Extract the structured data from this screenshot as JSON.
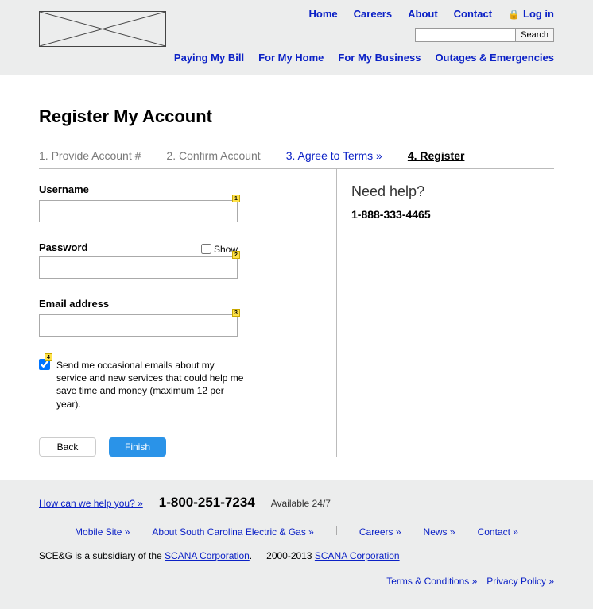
{
  "header": {
    "topNav": {
      "home": "Home",
      "careers": "Careers",
      "about": "About",
      "contact": "Contact",
      "login": "Log in"
    },
    "search": {
      "button": "Search"
    },
    "mainNav": {
      "bill": "Paying My Bill",
      "home": "For My Home",
      "business": "For My Business",
      "outages": "Outages & Emergencies"
    }
  },
  "page": {
    "title": "Register My Account",
    "steps": {
      "s1": "1. Provide Account #",
      "s2": "2. Confirm Account",
      "s3": "3. Agree to Terms »",
      "s4": "4. Register"
    },
    "form": {
      "usernameLabel": "Username",
      "passwordLabel": "Password",
      "showLabel": "Show",
      "emailLabel": "Email address",
      "checkboxText": "Send me occasional emails about my service and new services that could help me save time and money (maximum 12 per year).",
      "back": "Back",
      "finish": "Finish",
      "badge1": "1",
      "badge2": "2",
      "badge3": "3",
      "badge4": "4"
    },
    "help": {
      "title": "Need help?",
      "phone": "1-888-333-4465"
    }
  },
  "footer": {
    "helpLink": "How can we help you? »",
    "bigPhone": "1-800-251-7234",
    "avail": "Available 24/7",
    "links": {
      "mobile": "Mobile Site »",
      "aboutSce": "About South Carolina Electric & Gas »",
      "careers": "Careers »",
      "news": "News »",
      "contact": "Contact »"
    },
    "subText1a": "SCE&G is a subsidiary of the ",
    "subText1b": "SCANA Corporation",
    "subText1c": ".",
    "subText2a": "2000-2013 ",
    "subText2b": "SCANA Corporation",
    "terms": "Terms & Conditions »",
    "privacy": "Privacy Policy »"
  }
}
